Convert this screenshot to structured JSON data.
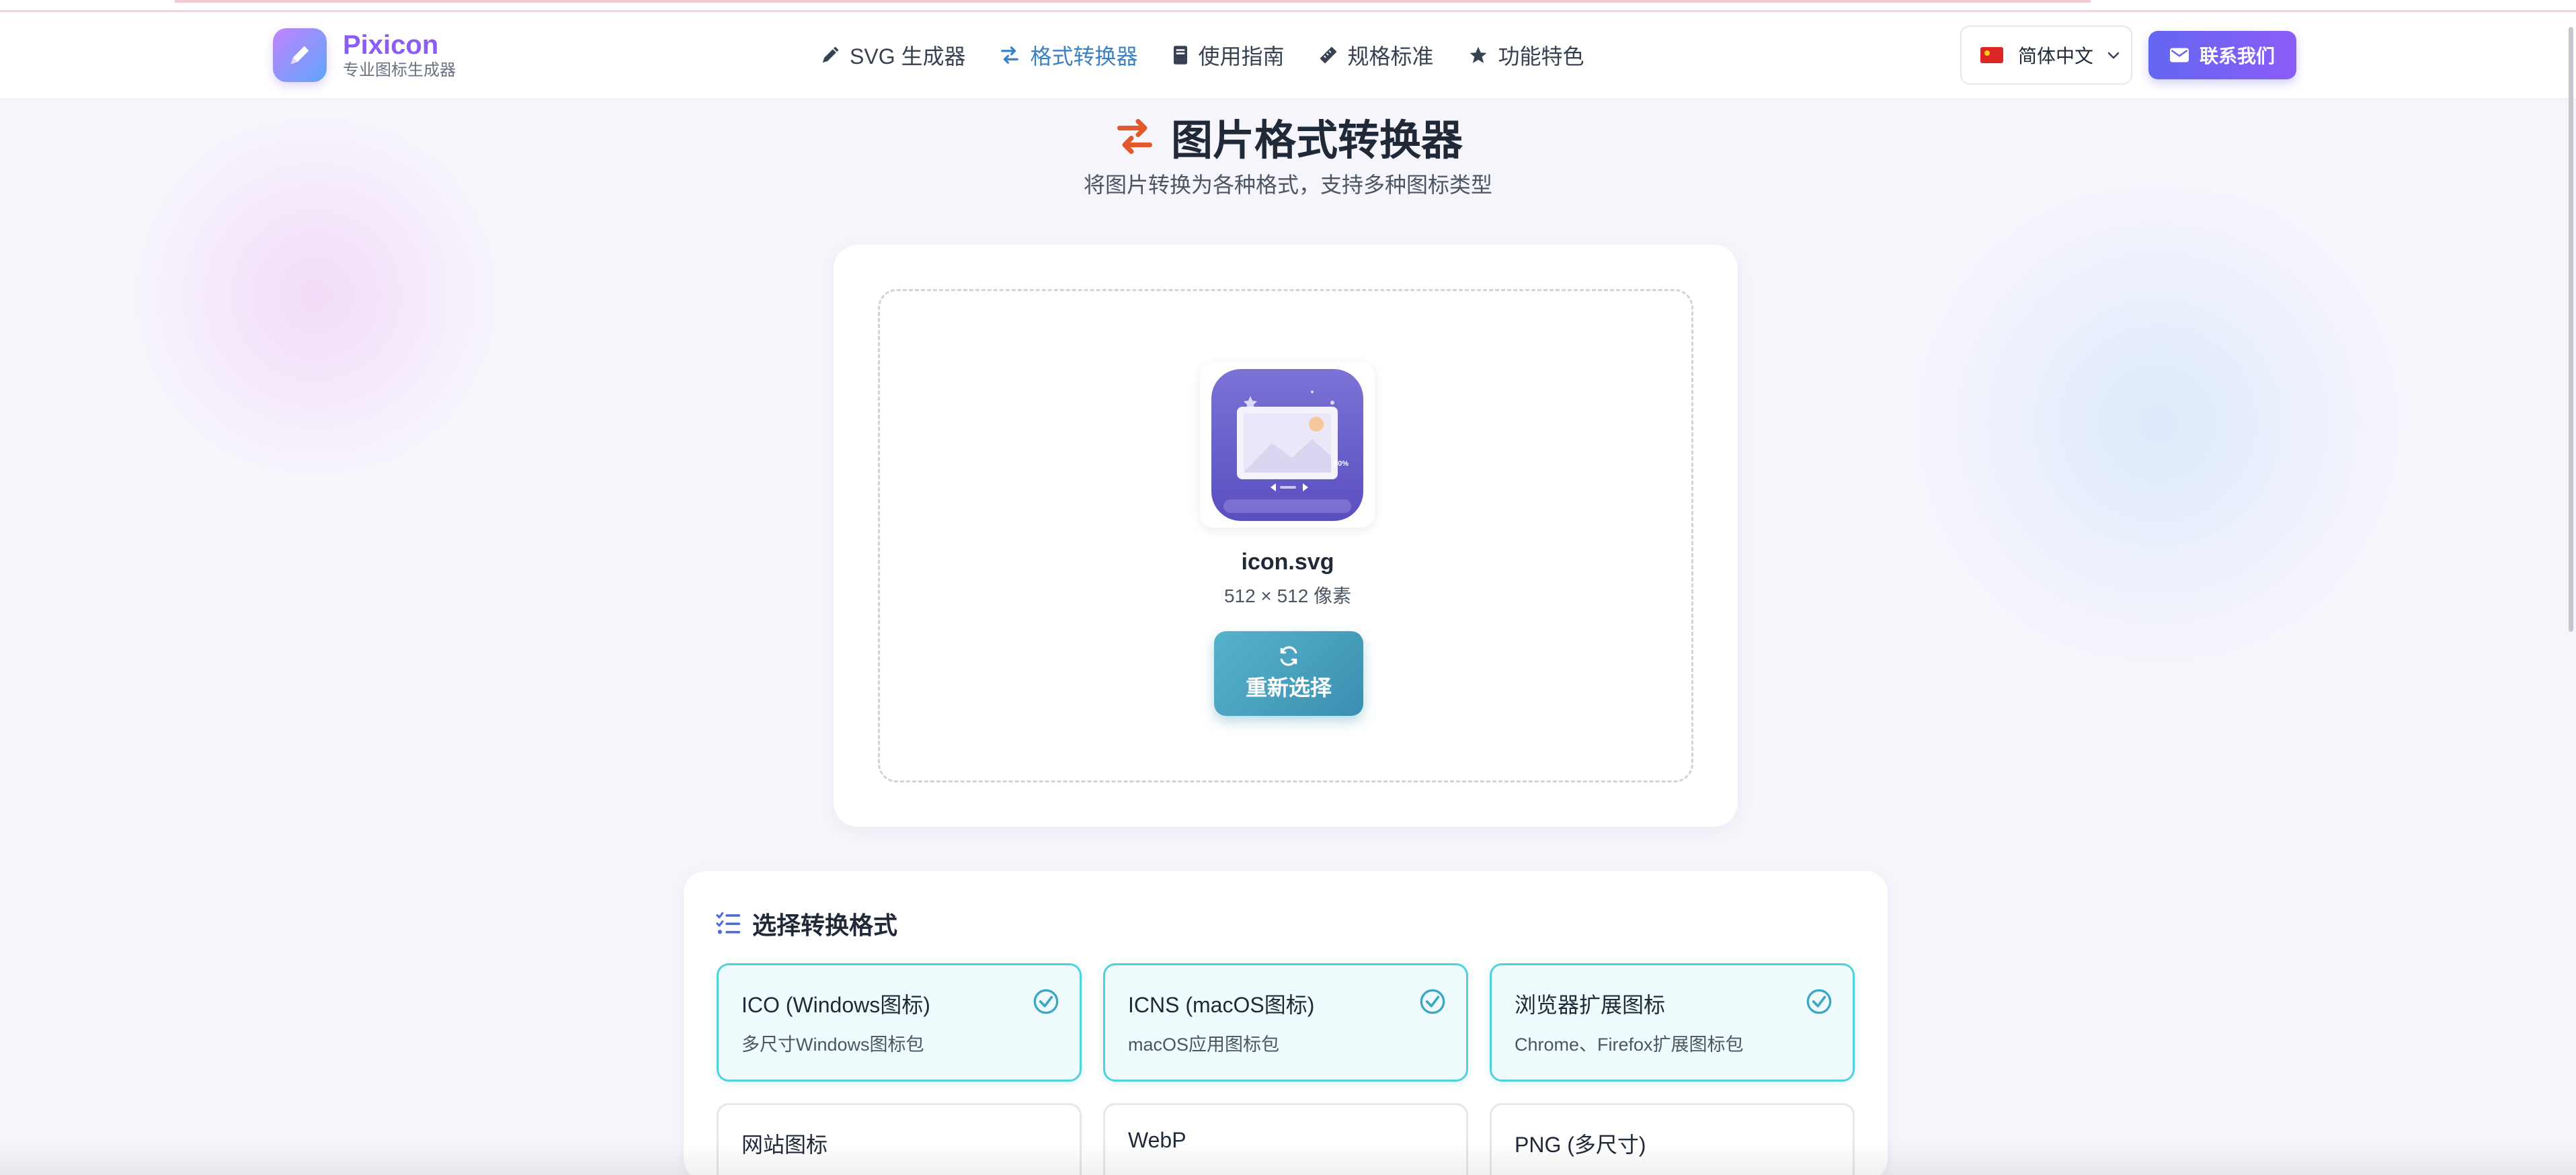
{
  "brand": {
    "name": "Pixicon",
    "subtitle": "专业图标生成器"
  },
  "nav": {
    "items": [
      {
        "label": "SVG 生成器",
        "icon": "pen-icon",
        "active": false
      },
      {
        "label": "格式转换器",
        "icon": "arrows-exchange-icon",
        "active": true
      },
      {
        "label": "使用指南",
        "icon": "book-icon",
        "active": false
      },
      {
        "label": "规格标准",
        "icon": "ruler-icon",
        "active": false
      },
      {
        "label": "功能特色",
        "icon": "star-icon",
        "active": false
      }
    ],
    "language": "简体中文",
    "contact_label": "联系我们"
  },
  "hero": {
    "title": "图片格式转换器",
    "subtitle": "将图片转换为各种格式，支持多种图标类型"
  },
  "upload": {
    "file_name": "icon.svg",
    "dimensions": "512 × 512 像素",
    "reselect_label": "重新选择",
    "preview_label": "80%"
  },
  "formats": {
    "heading": "选择转换格式",
    "options": [
      {
        "title": "ICO (Windows图标)",
        "desc": "多尺寸Windows图标包",
        "selected": true
      },
      {
        "title": "ICNS (macOS图标)",
        "desc": "macOS应用图标包",
        "selected": true
      },
      {
        "title": "浏览器扩展图标",
        "desc": "Chrome、Firefox扩展图标包",
        "selected": true
      },
      {
        "title": "网站图标",
        "desc": "",
        "selected": false
      },
      {
        "title": "WebP",
        "desc": "",
        "selected": false
      },
      {
        "title": "PNG (多尺寸)",
        "desc": "",
        "selected": false
      }
    ]
  },
  "colors": {
    "brand_purple": "#8b5cf6",
    "active_nav": "#3b82c4",
    "selected_border": "#4fd1e0",
    "accent_orange": "#e2572b"
  }
}
